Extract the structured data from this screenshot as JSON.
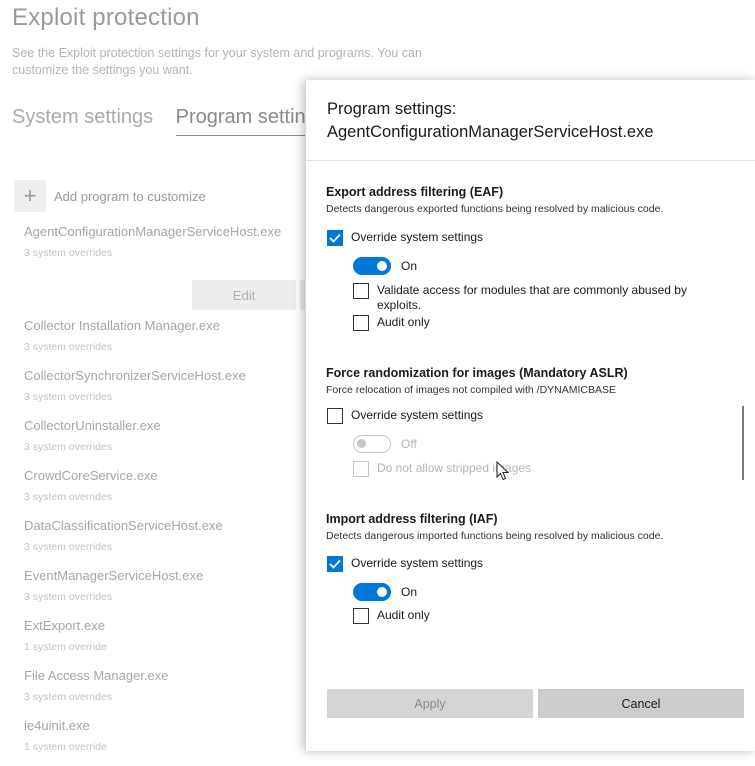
{
  "page": {
    "title": "Exploit protection",
    "description": "See the Exploit protection settings for your system and programs.  You can customize the settings you want.",
    "tabs": [
      {
        "label": "System settings"
      },
      {
        "label": "Program settings"
      }
    ],
    "add_program_label": "Add program to customize",
    "edit_label": "Edit",
    "programs": [
      {
        "name": "AgentConfigurationManagerServiceHost.exe",
        "overrides": "3 system overrides"
      },
      {
        "name": "Collector Installation Manager.exe",
        "overrides": "3 system overrides"
      },
      {
        "name": "CollectorSynchronizerServiceHost.exe",
        "overrides": "3 system overrides"
      },
      {
        "name": "CollectorUninstaller.exe",
        "overrides": "3 system overrides"
      },
      {
        "name": "CrowdCoreService.exe",
        "overrides": "3 system overrides"
      },
      {
        "name": "DataClassificationServiceHost.exe",
        "overrides": "3 system overrides"
      },
      {
        "name": "EventManagerServiceHost.exe",
        "overrides": "3 system overrides"
      },
      {
        "name": "ExtExport.exe",
        "overrides": "1 system override"
      },
      {
        "name": "File Access Manager.exe",
        "overrides": "3 system overrides"
      },
      {
        "name": "ie4uinit.exe",
        "overrides": "1 system override"
      }
    ]
  },
  "dialog": {
    "title_line1": "Program settings:",
    "title_line2": "AgentConfigurationManagerServiceHost.exe",
    "eaf": {
      "title": "Export address filtering (EAF)",
      "description": "Detects dangerous exported functions being resolved by malicious code.",
      "override_label": "Override system settings",
      "override_checked": true,
      "toggle_label": "On",
      "toggle_on": true,
      "validate_label": "Validate access for modules that are commonly abused by exploits.",
      "validate_checked": false,
      "audit_label": "Audit only",
      "audit_checked": false
    },
    "aslr": {
      "title": "Force randomization for images (Mandatory ASLR)",
      "description": "Force relocation of images not compiled with /DYNAMICBASE",
      "override_label": "Override system settings",
      "override_checked": false,
      "toggle_label": "Off",
      "toggle_on": false,
      "stripped_label": "Do not allow stripped images",
      "stripped_checked": false
    },
    "iaf": {
      "title": "Import address filtering (IAF)",
      "description": "Detects dangerous imported functions being resolved by malicious code.",
      "override_label": "Override system settings",
      "override_checked": true,
      "toggle_label": "On",
      "toggle_on": true,
      "audit_label": "Audit only",
      "audit_checked": false
    },
    "apply_label": "Apply",
    "cancel_label": "Cancel"
  },
  "colors": {
    "accent": "#0078d7",
    "disabled_text": "#b5b5b5"
  }
}
